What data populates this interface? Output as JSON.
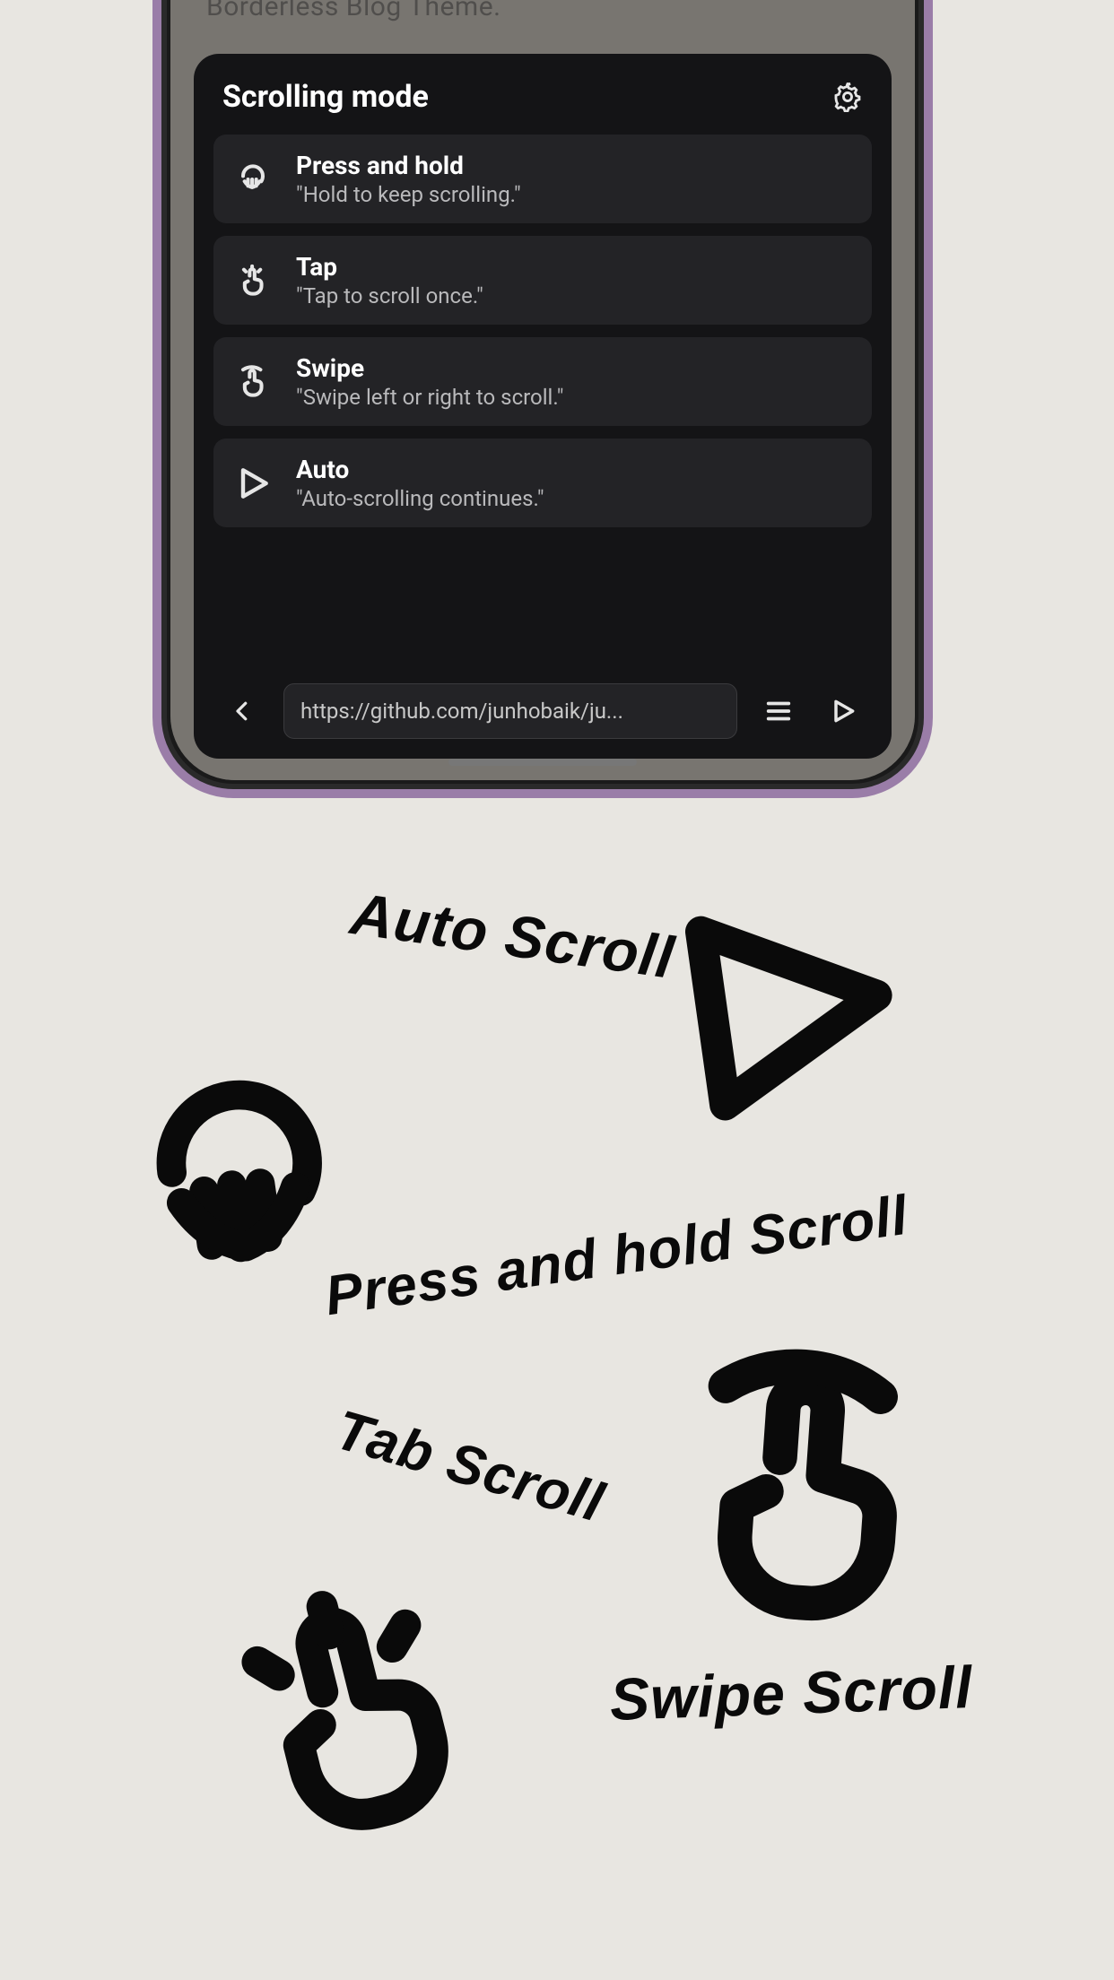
{
  "page_bg_text": "Borderless Blog Theme.",
  "panel": {
    "title": "Scrolling mode",
    "modes": [
      {
        "icon": "press-hold-icon",
        "title": "Press and hold",
        "desc": "\"Hold to keep scrolling.\""
      },
      {
        "icon": "tap-icon",
        "title": "Tap",
        "desc": "\"Tap to scroll once.\""
      },
      {
        "icon": "swipe-icon",
        "title": "Swipe",
        "desc": "\"Swipe left or right to scroll.\""
      },
      {
        "icon": "play-icon",
        "title": "Auto",
        "desc": "\"Auto-scrolling continues.\""
      }
    ]
  },
  "url": "https://github.com/junhobaik/ju...",
  "decor": {
    "auto": "Auto Scroll",
    "press": "Press and hold Scroll",
    "tab": "Tab Scroll",
    "swipe": "Swipe Scroll"
  }
}
